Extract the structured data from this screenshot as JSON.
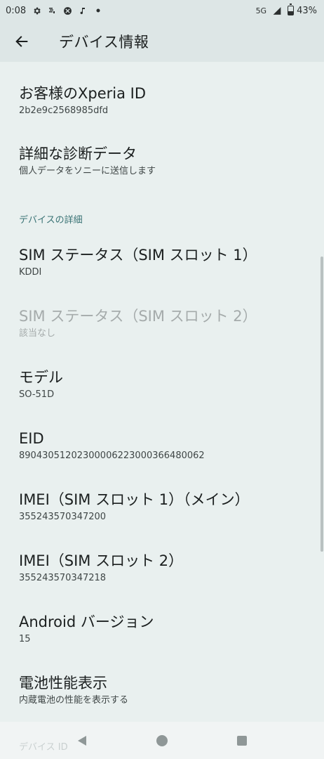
{
  "status_bar": {
    "time": "0:08",
    "network": "5G",
    "battery_percent": "43%",
    "battery_level": 0.43,
    "left_icons": [
      "gear-icon",
      "sim-toolkit-icon",
      "xbox-icon",
      "music-note-icon",
      "dot-icon"
    ],
    "right_icons": [
      "signal-icon",
      "battery-icon"
    ]
  },
  "app_bar": {
    "title": "デバイス情報",
    "back_icon": "arrow-left-icon"
  },
  "items": [
    {
      "title": "お客様のXperia ID",
      "subtitle": "2b2e9c2568985dfd"
    },
    {
      "title": "詳細な診断データ",
      "subtitle": "個人データをソニーに送信します"
    }
  ],
  "section": {
    "header": "デバイスの詳細"
  },
  "details": [
    {
      "title": "SIM ステータス（SIM スロット 1）",
      "subtitle": "KDDI",
      "enabled": true
    },
    {
      "title": "SIM ステータス（SIM スロット 2）",
      "subtitle": "該当なし",
      "enabled": false
    },
    {
      "title": "モデル",
      "subtitle": "SO-51D",
      "enabled": true
    },
    {
      "title": "EID",
      "subtitle": "89043051202300006223000366480062",
      "enabled": true
    },
    {
      "title": "IMEI（SIM スロット 1）（メイン）",
      "subtitle": "355243570347200",
      "enabled": true
    },
    {
      "title": "IMEI（SIM スロット 2）",
      "subtitle": "355243570347218",
      "enabled": true
    },
    {
      "title": "Android バージョン",
      "subtitle": "15",
      "enabled": true
    },
    {
      "title": "電池性能表示",
      "subtitle": "内蔵電池の性能を表示する",
      "enabled": true
    }
  ],
  "peek": {
    "label": "デバイス ID"
  },
  "nav_bar": {
    "icons": [
      "nav-back-icon",
      "nav-home-icon",
      "nav-recents-icon"
    ]
  },
  "colors": {
    "background": "#e9f0ef",
    "app_bar": "#dde6e6",
    "section_header": "#3a7375",
    "disabled_text": "#a5abab"
  }
}
